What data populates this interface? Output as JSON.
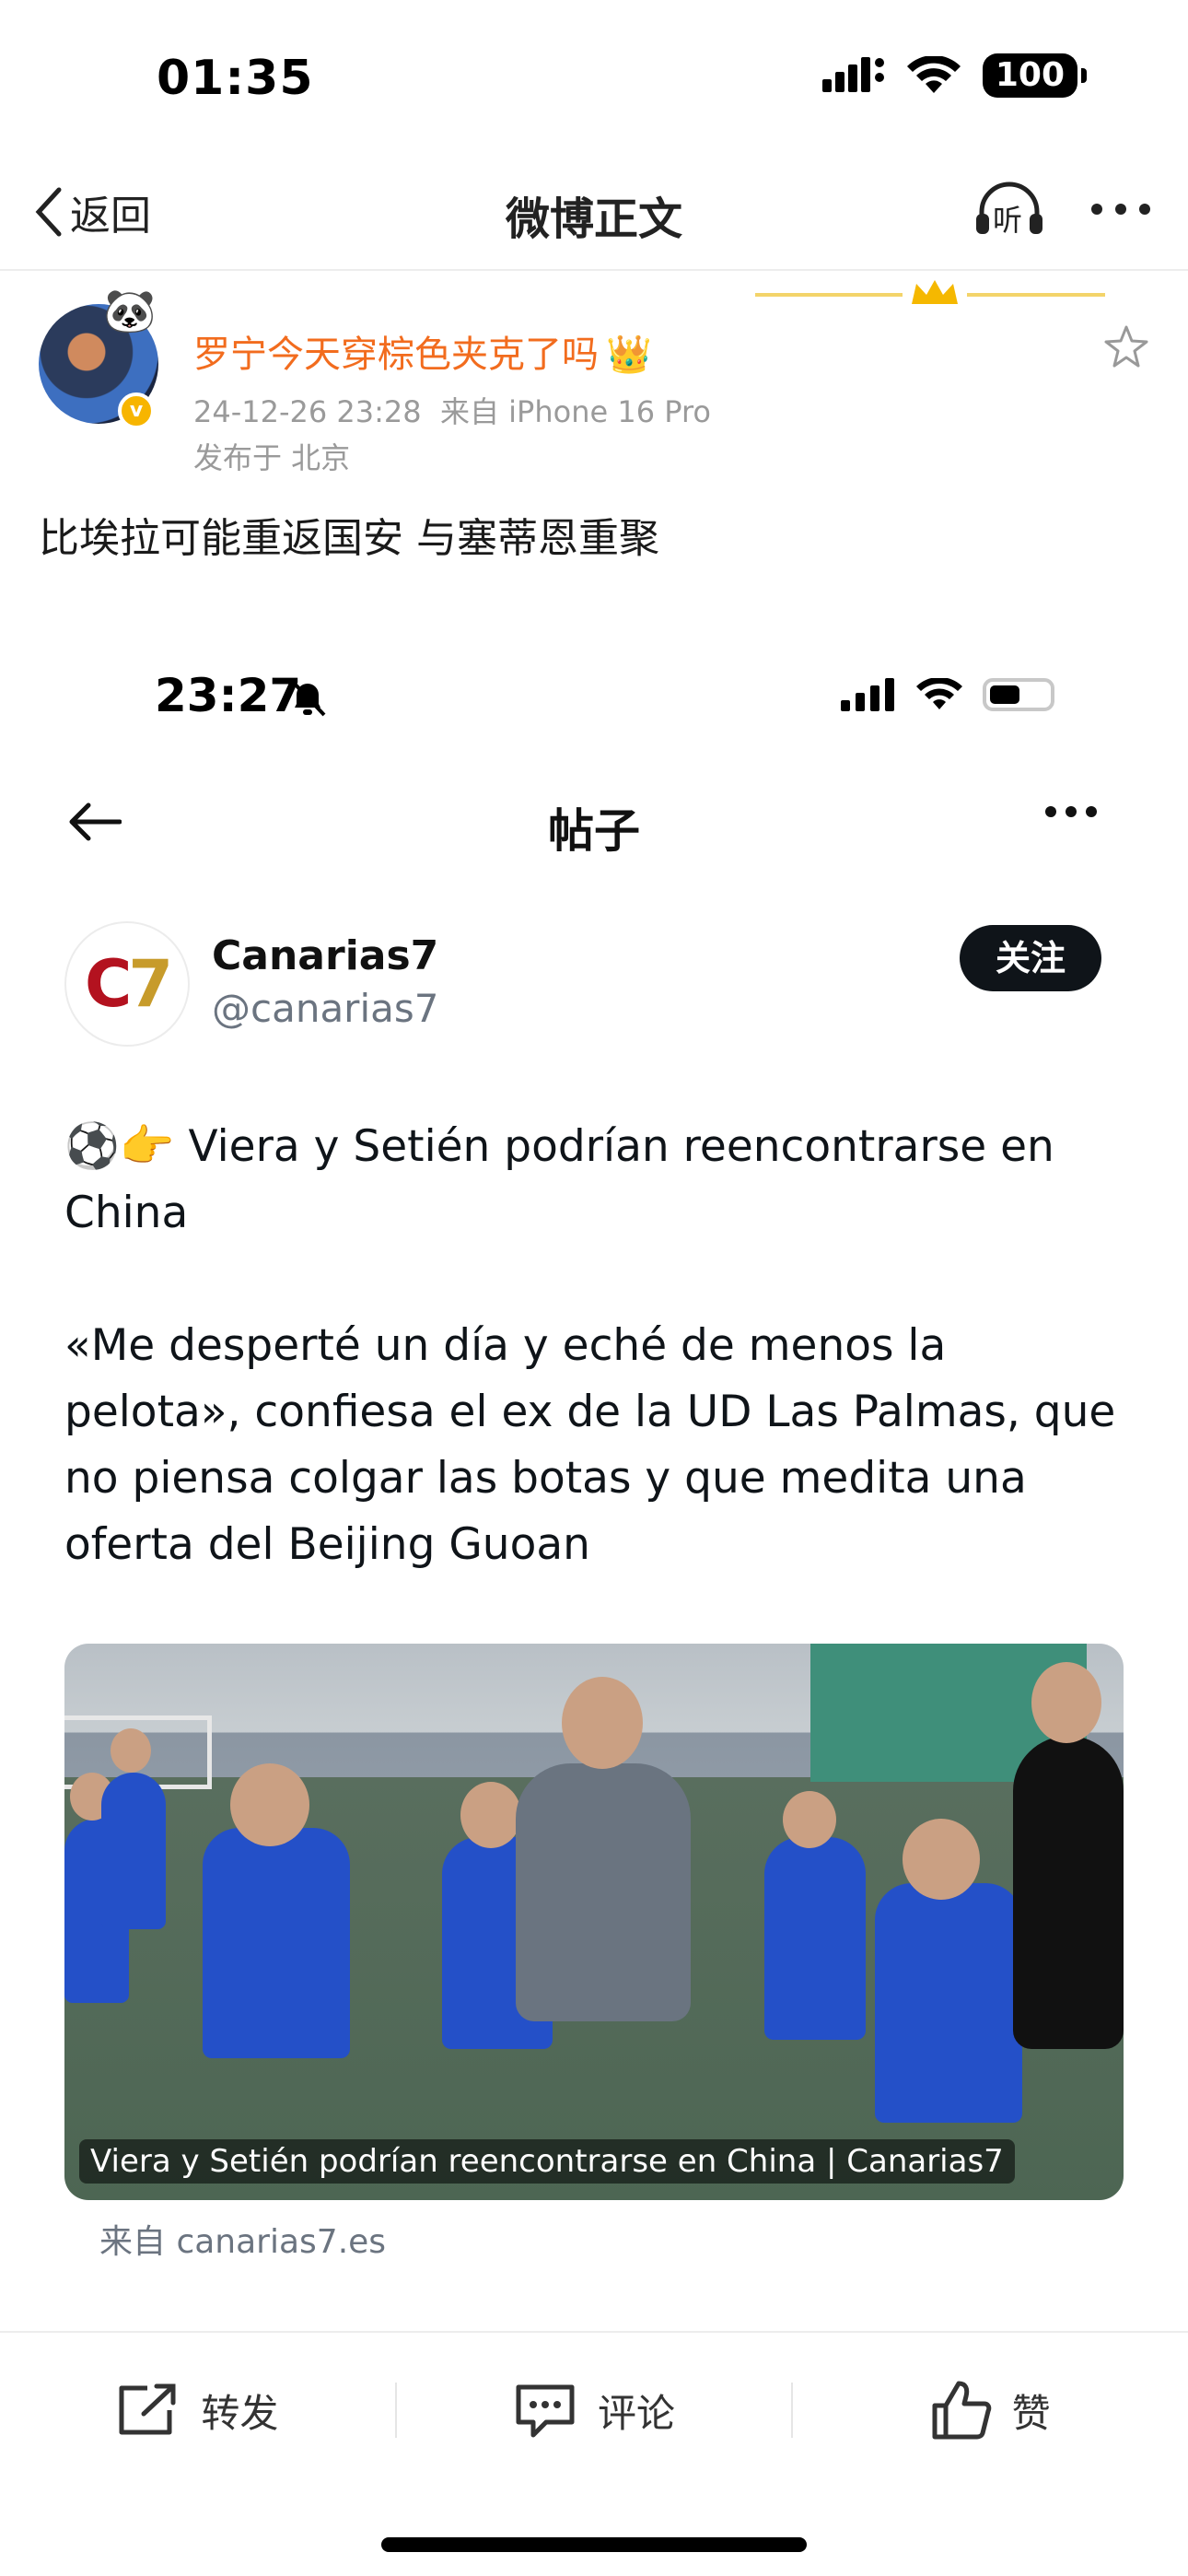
{
  "status_bar": {
    "time": "01:35",
    "battery": "100"
  },
  "nav": {
    "back_label": "返回",
    "title": "微博正文",
    "listen_label": "听"
  },
  "post": {
    "username": "罗宁今天穿棕色夹克了吗",
    "crown_badge": "👑",
    "timestamp": "24-12-26 23:28",
    "source": "来自 iPhone 16 Pro",
    "location": "发布于 北京",
    "text": "比埃拉可能重返国安 与塞蒂恩重聚"
  },
  "embedded": {
    "status_time": "23:27",
    "nav_title": "帖子",
    "account": {
      "name": "Canarias7",
      "handle": "@canarias7",
      "logo_c": "C",
      "logo_7": "7",
      "follow_label": "关注"
    },
    "tweet": {
      "emojis": "⚽👉",
      "line1": "Viera y Setién podrían reencontrarse en China",
      "line2": "«Me desperté un día y eché de menos la pelota», confiesa el ex de la UD Las Palmas, que no piensa colgar las botas y que medita una oferta del Beijing Guoan"
    },
    "photo_caption": "Viera y Setién podrían reencontrarse en China | Canarias7",
    "link_source": "来自 canarias7.es"
  },
  "toolbar": {
    "repost_label": "转发",
    "comment_label": "评论",
    "like_label": "赞"
  },
  "colors": {
    "username": "#f26c1e",
    "verified": "#f7b500",
    "follow_bg": "#0f1419"
  }
}
